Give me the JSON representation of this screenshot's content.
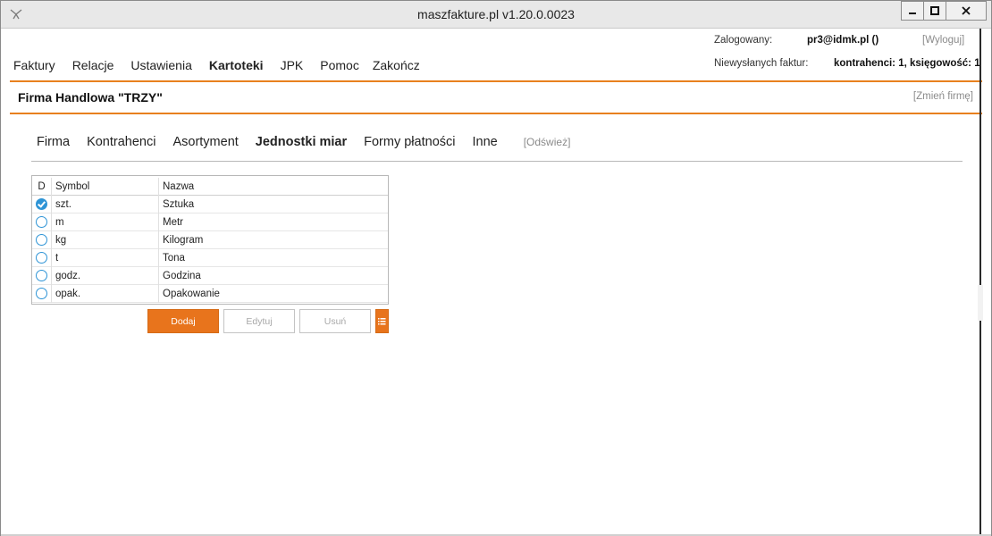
{
  "window": {
    "title": "maszfakture.pl  v1.20.0.0023"
  },
  "menu": {
    "items": [
      {
        "label": "Faktury"
      },
      {
        "label": "Relacje"
      },
      {
        "label": "Ustawienia"
      },
      {
        "label": "Kartoteki",
        "active": true
      },
      {
        "label": "JPK"
      },
      {
        "label": "Pomoc"
      },
      {
        "label": "Zakończ"
      }
    ]
  },
  "account": {
    "logged_label": "Zalogowany:",
    "user": "pr3@idmk.pl ()",
    "logout": "[Wyloguj]",
    "unsent_label": "Niewysłanych faktur:",
    "unsent_value": "kontrahenci: 1, księgowość: 1"
  },
  "firm": {
    "name": "Firma Handlowa \"TRZY\"",
    "change": "[Zmień firmę]"
  },
  "tabs": {
    "items": [
      {
        "label": "Firma"
      },
      {
        "label": "Kontrahenci"
      },
      {
        "label": "Asortyment"
      },
      {
        "label": "Jednostki miar",
        "active": true
      },
      {
        "label": "Formy płatności"
      },
      {
        "label": "Inne"
      }
    ],
    "refresh": "[Odśwież]"
  },
  "units_table": {
    "columns": [
      "D",
      "Symbol",
      "Nazwa"
    ],
    "rows": [
      {
        "default": true,
        "symbol": "szt.",
        "name": "Sztuka"
      },
      {
        "default": false,
        "symbol": "m",
        "name": "Metr"
      },
      {
        "default": false,
        "symbol": "kg",
        "name": "Kilogram"
      },
      {
        "default": false,
        "symbol": "t",
        "name": "Tona"
      },
      {
        "default": false,
        "symbol": "godz.",
        "name": "Godzina"
      },
      {
        "default": false,
        "symbol": "opak.",
        "name": "Opakowanie"
      }
    ]
  },
  "actions": {
    "add": "Dodaj",
    "edit": "Edytuj",
    "delete": "Usuń",
    "menu_icon": "list-icon"
  },
  "colors": {
    "accent": "#e8741c",
    "radio": "#2e94d6"
  }
}
